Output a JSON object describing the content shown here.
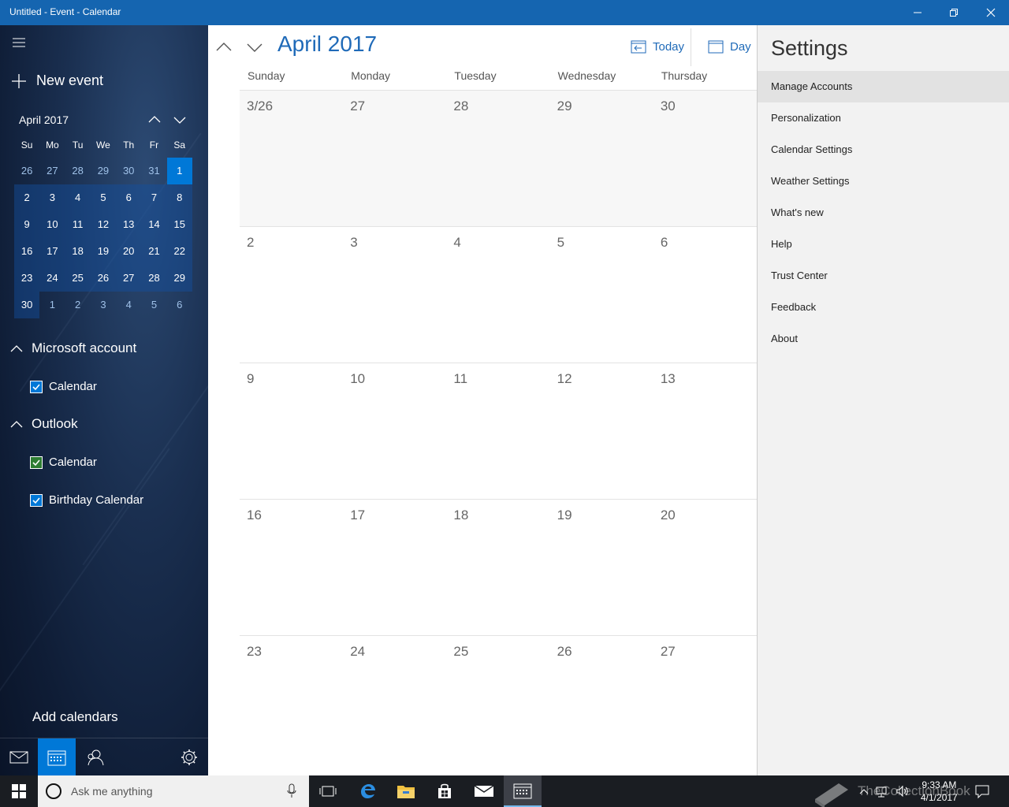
{
  "window": {
    "title": "Untitled - Event - Calendar"
  },
  "sidebar": {
    "new_event": "New event",
    "mini": {
      "month": "April 2017",
      "dow": [
        "Su",
        "Mo",
        "Tu",
        "We",
        "Th",
        "Fr",
        "Sa"
      ],
      "weeks": [
        [
          "26",
          "27",
          "28",
          "29",
          "30",
          "31",
          "1"
        ],
        [
          "2",
          "3",
          "4",
          "5",
          "6",
          "7",
          "8"
        ],
        [
          "9",
          "10",
          "11",
          "12",
          "13",
          "14",
          "15"
        ],
        [
          "16",
          "17",
          "18",
          "19",
          "20",
          "21",
          "22"
        ],
        [
          "23",
          "24",
          "25",
          "26",
          "27",
          "28",
          "29"
        ],
        [
          "30",
          "1",
          "2",
          "3",
          "4",
          "5",
          "6"
        ]
      ]
    },
    "microsoft_account": "Microsoft account",
    "ms_calendar": "Calendar",
    "outlook": "Outlook",
    "outlook_calendar": "Calendar",
    "birthday_calendar": "Birthday Calendar",
    "add_calendars": "Add calendars"
  },
  "main": {
    "month_title": "April 2017",
    "today": "Today",
    "day": "Day",
    "dow": [
      "Sunday",
      "Monday",
      "Tuesday",
      "Wednesday",
      "Thursday"
    ],
    "weeks": [
      [
        "3/26",
        "27",
        "28",
        "29",
        "30"
      ],
      [
        "2",
        "3",
        "4",
        "5",
        "6"
      ],
      [
        "9",
        "10",
        "11",
        "12",
        "13"
      ],
      [
        "16",
        "17",
        "18",
        "19",
        "20"
      ],
      [
        "23",
        "24",
        "25",
        "26",
        "27"
      ]
    ]
  },
  "settings": {
    "title": "Settings",
    "items": [
      "Manage Accounts",
      "Personalization",
      "Calendar Settings",
      "Weather Settings",
      "What's new",
      "Help",
      "Trust Center",
      "Feedback",
      "About"
    ]
  },
  "taskbar": {
    "search_placeholder": "Ask me anything",
    "time": "9:33 AM",
    "date": "4/1/2017",
    "watermark": "TheCollectionBook"
  },
  "colors": {
    "accent": "#0078d7",
    "titlebar": "#1565b0",
    "link": "#1f6ab8"
  }
}
